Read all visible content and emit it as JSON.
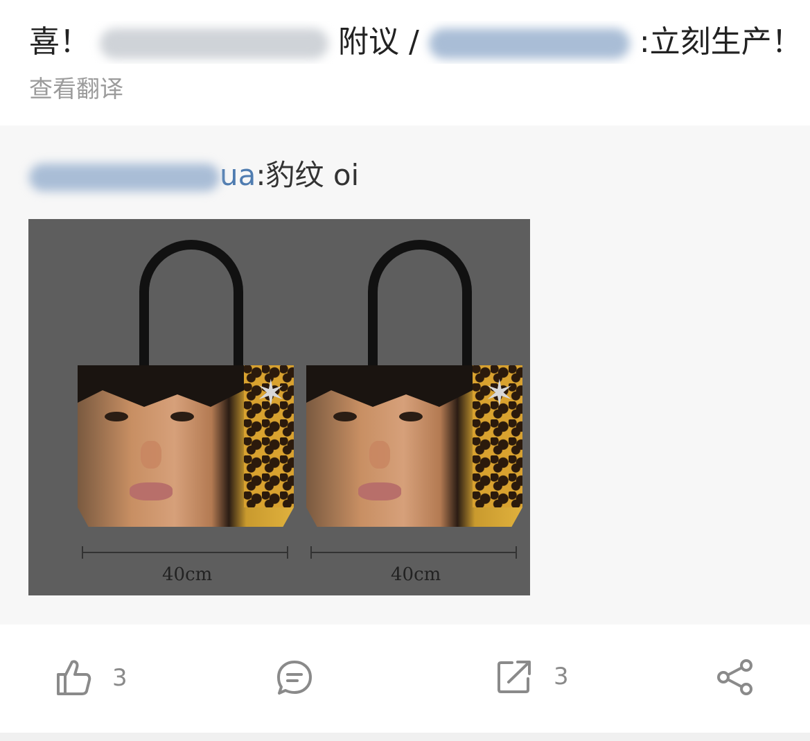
{
  "post": {
    "text_start": "喜！",
    "text_mid": "附议 /",
    "text_end": ":立刻生产！",
    "translate_label": "查看翻译"
  },
  "repost": {
    "user_suffix": "ua",
    "comment": ":豹纹 oi"
  },
  "product": {
    "left_size": "40cm",
    "right_size": "40cm"
  },
  "actions": {
    "like_count": "3",
    "repost_count": "3",
    "like_icon": "thumbs-up-icon",
    "comment_icon": "comment-icon",
    "repost_icon": "repost-icon",
    "share_icon": "share-icon"
  },
  "colors": {
    "mention": "#4f7cb0",
    "muted": "#9b9b9b",
    "repost_bg": "#f7f7f7",
    "image_bg": "#5e5e5e"
  }
}
